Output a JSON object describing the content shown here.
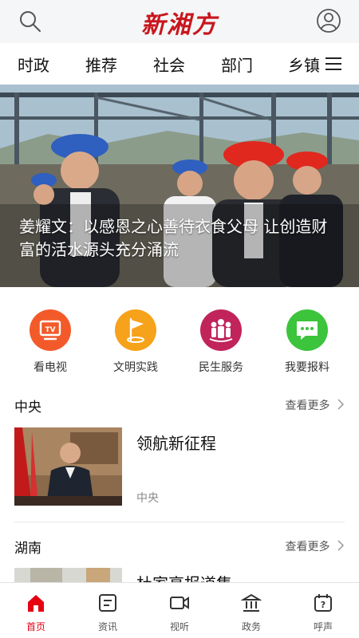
{
  "header": {
    "logo_text": "新湘方",
    "search_icon": "search-icon",
    "user_icon": "user-icon"
  },
  "tabs": [
    {
      "label": "时政"
    },
    {
      "label": "推荐"
    },
    {
      "label": "社会"
    },
    {
      "label": "部门"
    },
    {
      "label": "乡镇"
    }
  ],
  "banner": {
    "caption": "姜耀文：以感恩之心善待衣食父母 让创造财富的活水源头充分涌流",
    "slide_count": 4,
    "active_slide": 1
  },
  "quick_links": [
    {
      "label": "看电视",
      "icon": "tv-icon",
      "color": "#f35a2a"
    },
    {
      "label": "文明实践",
      "icon": "flag-icon",
      "color": "#f6a21a"
    },
    {
      "label": "民生服务",
      "icon": "people-icon",
      "color": "#c0245a"
    },
    {
      "label": "我要报料",
      "icon": "chat-icon",
      "color": "#3cc43c"
    }
  ],
  "sections": [
    {
      "title": "中央",
      "more_label": "查看更多",
      "item": {
        "title": "领航新征程",
        "source": "中央"
      }
    },
    {
      "title": "湖南",
      "more_label": "查看更多",
      "item": {
        "title": "杜家亮报道集",
        "source": ""
      }
    }
  ],
  "bottom_nav": [
    {
      "label": "首页",
      "icon": "home-icon",
      "active": true
    },
    {
      "label": "资讯",
      "icon": "news-icon",
      "active": false
    },
    {
      "label": "视听",
      "icon": "video-icon",
      "active": false
    },
    {
      "label": "政务",
      "icon": "government-icon",
      "active": false
    },
    {
      "label": "呼声",
      "icon": "feedback-icon",
      "active": false
    }
  ],
  "colors": {
    "brand_red": "#e60012",
    "logo_red": "#c8161d"
  }
}
